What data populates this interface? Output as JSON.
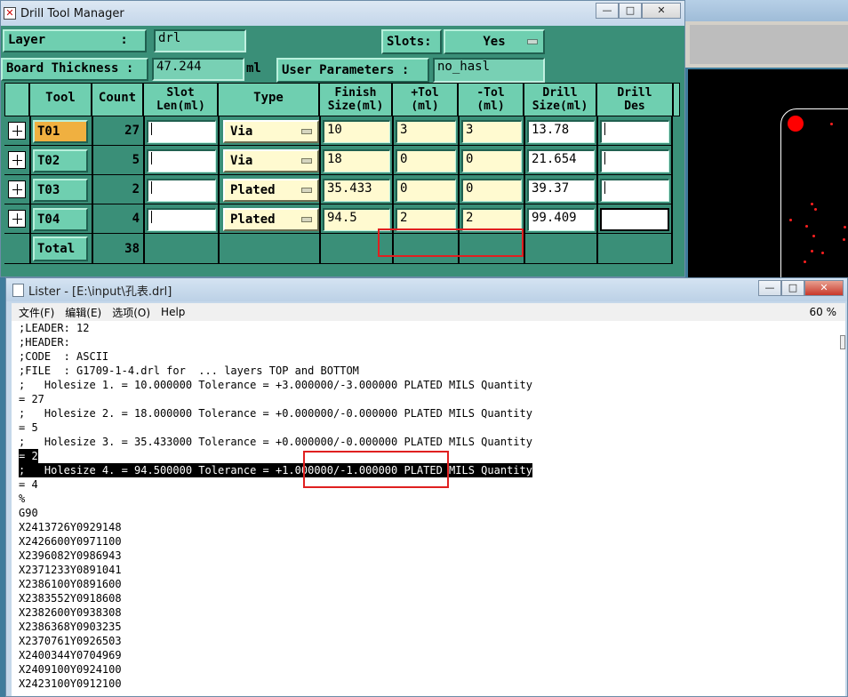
{
  "dtm": {
    "title": "Drill Tool Manager",
    "win_min": "—",
    "win_max": "□",
    "win_close": "✕",
    "layer_label": "Layer          :",
    "layer_value": "drl",
    "slots_label": "Slots:",
    "slots_value": "Yes",
    "thickness_label": "Board Thickness :",
    "thickness_value": "47.244",
    "thickness_unit": "ml",
    "user_params_label": "User Parameters :",
    "user_params_value": "no_hasl",
    "headers": {
      "tool": "Tool",
      "count": "Count",
      "slot_len": "Slot Len(ml)",
      "type": "Type",
      "finish_size": "Finish Size(ml)",
      "plus_tol": "+Tol (ml)",
      "minus_tol": "-Tol (ml)",
      "drill_size": "Drill Size(ml)",
      "drill_des": "Drill Des"
    },
    "rows": [
      {
        "tool": "T01",
        "count": "27",
        "type": "Via",
        "finish": "10",
        "plus_tol": "3",
        "minus_tol": "3",
        "drill": "13.78"
      },
      {
        "tool": "T02",
        "count": "5",
        "type": "Via",
        "finish": "18",
        "plus_tol": "0",
        "minus_tol": "0",
        "drill": "21.654"
      },
      {
        "tool": "T03",
        "count": "2",
        "type": "Plated",
        "finish": "35.433",
        "plus_tol": "0",
        "minus_tol": "0",
        "drill": "39.37"
      },
      {
        "tool": "T04",
        "count": "4",
        "type": "Plated",
        "finish": "94.5",
        "plus_tol": "2",
        "minus_tol": "2",
        "drill": "99.409"
      }
    ],
    "total_label": "Total",
    "total_count": "38"
  },
  "lister": {
    "title": "Lister - [E:\\input\\孔表.drl]",
    "menu": {
      "file": "文件(F)",
      "edit": "编辑(E)",
      "options": "选项(O)",
      "help": "Help"
    },
    "zoom": "60 %",
    "lines": [
      ";LEADER: 12",
      ";HEADER:",
      ";CODE  : ASCII",
      ";FILE  : G1709-1-4.drl for  ... layers TOP and BOTTOM",
      ";   Holesize 1. = 10.000000 Tolerance = +3.000000/-3.000000 PLATED MILS Quantity",
      "= 27",
      ";   Holesize 2. = 18.000000 Tolerance = +0.000000/-0.000000 PLATED MILS Quantity",
      "= 5",
      ";   Holesize 3. = 35.433000 Tolerance = +0.000000/-0.000000 PLATED MILS Quantity",
      "= 2",
      ";   Holesize 4. = 94.500000 Tolerance = +1.000000/-1.000000 PLATED MILS Quantity",
      "= 4",
      "%",
      "G90",
      "X2413726Y0929148",
      "X2426600Y0971100",
      "X2396082Y0986943",
      "X2371233Y0891041",
      "X2386100Y0891600",
      "X2383552Y0918608",
      "X2382600Y0938308",
      "X2386368Y0903235",
      "X2370761Y0926503",
      "X2400344Y0704969",
      "X2409100Y0924100",
      "X2423100Y0912100"
    ]
  }
}
